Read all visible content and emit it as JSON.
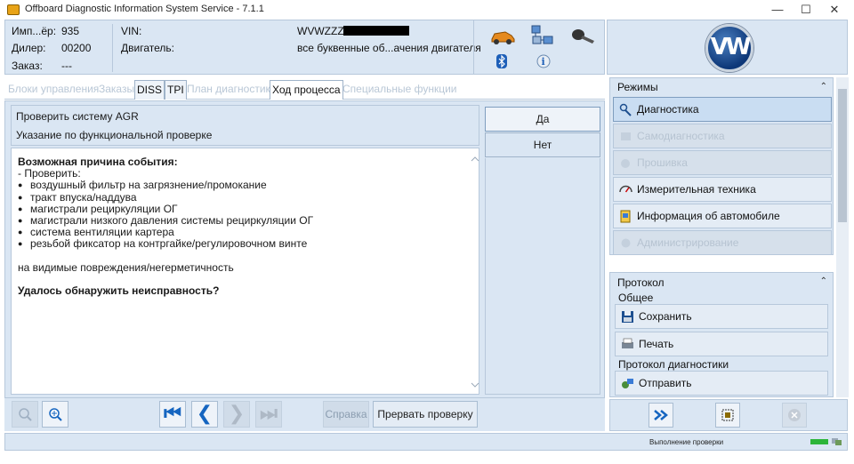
{
  "window": {
    "title": "Offboard Diagnostic Information System Service - 7.1.1",
    "minimize_glyph": "—",
    "maximize_glyph": "☐",
    "close_glyph": "✕"
  },
  "header": {
    "importer_label": "Имп...ёр:",
    "importer_value": "935",
    "dealer_label": "Дилер:",
    "dealer_value": "00200",
    "order_label": "Заказ:",
    "order_value": "---",
    "vin_label": "VIN:",
    "vin_value": "WVWZZZ3",
    "engine_label": "Двигатель:",
    "engine_value": "все буквенные об...ачения двигателя",
    "icons": [
      "car-icon",
      "network-icon",
      "key-icon",
      "bluetooth-icon",
      "info-icon"
    ]
  },
  "brand": {
    "logo": "VW"
  },
  "tabs": [
    {
      "label": "Блоки управления",
      "state": "disabled"
    },
    {
      "label": "Заказы",
      "state": "disabled"
    },
    {
      "label": "DISS",
      "state": "enabled"
    },
    {
      "label": "TPI",
      "state": "enabled"
    },
    {
      "label": "План диагностики",
      "state": "disabled"
    },
    {
      "label": "Ход процесса",
      "state": "active"
    },
    {
      "label": "Специальные функции",
      "state": "disabled"
    }
  ],
  "question": {
    "title": "Проверить систему AGR",
    "subtitle": "Указание по функциональной проверке"
  },
  "answers": {
    "yes": "Да",
    "no": "Нет"
  },
  "content": {
    "heading": "Возможная причина события:",
    "intro": "- Проверить:",
    "items": [
      "воздушный фильтр на загрязнение/промокание",
      "тракт впуска/наддува",
      "магистрали рециркуляции ОГ",
      "магистрали низкого давления системы рециркуляции ОГ",
      "система вентиляции картера",
      "резьбой фиксатор на контргайке/регулировочном винте"
    ],
    "note": "на видимые повреждения/негерметичность",
    "question": "Удалось обнаружить неисправность?"
  },
  "toolbar": {
    "help_label": "Справка",
    "abort_label": "Прервать проверку",
    "first_glyph": "⏮",
    "prev_glyph": "❮",
    "next_glyph": "❯",
    "last_glyph": "⏭"
  },
  "modes": {
    "title": "Режимы",
    "collapse_glyph": "⌃",
    "items": [
      {
        "label": "Диагностика",
        "state": "active",
        "icon": "stethoscope-icon"
      },
      {
        "label": "Самодиагностика",
        "state": "disabled",
        "icon": "selfdiag-icon"
      },
      {
        "label": "Прошивка",
        "state": "disabled",
        "icon": "flash-icon"
      },
      {
        "label": "Измерительная техника",
        "state": "enabled",
        "icon": "gauge-icon"
      },
      {
        "label": "Информация об автомобиле",
        "state": "enabled",
        "icon": "vehicle-info-icon"
      },
      {
        "label": "Администрирование",
        "state": "disabled",
        "icon": "admin-icon"
      }
    ]
  },
  "protocol": {
    "title": "Протокол",
    "collapse_glyph": "⌃",
    "general_label": "Общее",
    "save_label": "Сохранить",
    "print_label": "Печать",
    "diag_protocol_label": "Протокол диагностики",
    "send_label": "Отправить"
  },
  "status": {
    "text": "Выполнение проверки"
  },
  "colors": {
    "panel_bg": "#dae6f3",
    "panel_border": "#b7c8db",
    "accent_blue": "#1565c0",
    "status_green": "#2db53a"
  }
}
